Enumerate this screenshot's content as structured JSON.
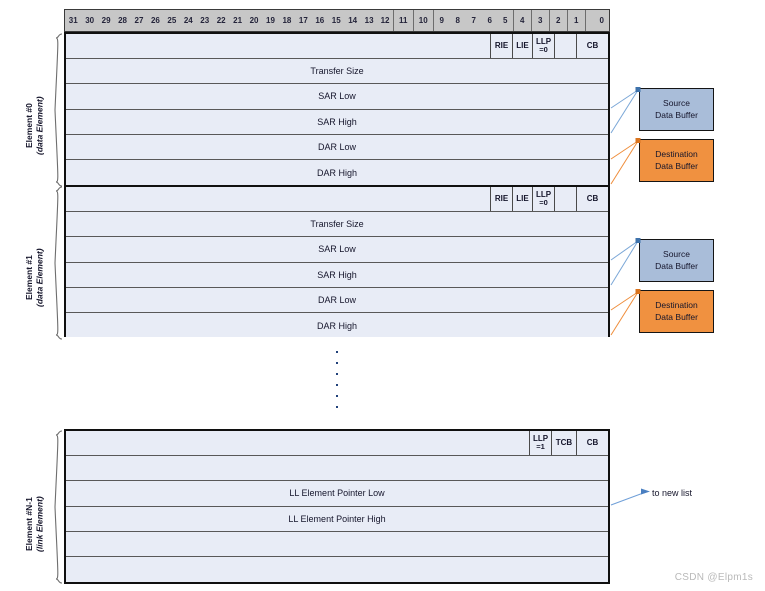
{
  "diagram": {
    "title": "DMA Linked List Element Layout",
    "watermark": "CSDN @Elpm1s"
  },
  "bit_header": {
    "bits": [
      "31",
      "30",
      "29",
      "28",
      "27",
      "26",
      "25",
      "24",
      "23",
      "22",
      "21",
      "20",
      "19",
      "18",
      "17",
      "16",
      "15",
      "14",
      "13",
      "12",
      "11",
      "10",
      "9",
      "8",
      "7",
      "6",
      "5",
      "4",
      "3",
      "2",
      "1",
      "0"
    ]
  },
  "elements": [
    {
      "id": "element-0",
      "label_line1": "Element #0",
      "label_line2": "(data Element)",
      "rows": [
        {
          "name": "control",
          "text": "",
          "flags": [
            {
              "label": "RIE",
              "sub": ""
            },
            {
              "label": "LIE",
              "sub": ""
            },
            {
              "label": "LLP",
              "sub": "=0"
            },
            {
              "label": "",
              "sub": ""
            },
            {
              "label": "CB",
              "sub": ""
            }
          ]
        },
        {
          "name": "transfer-size",
          "text": "Transfer Size"
        },
        {
          "name": "sar-low",
          "text": "SAR Low"
        },
        {
          "name": "sar-high",
          "text": "SAR High"
        },
        {
          "name": "dar-low",
          "text": "DAR Low"
        },
        {
          "name": "dar-high",
          "text": "DAR High"
        }
      ]
    },
    {
      "id": "element-1",
      "label_line1": "Element #1",
      "label_line2": "(data Element)",
      "rows": [
        {
          "name": "control",
          "text": "",
          "flags": [
            {
              "label": "RIE",
              "sub": ""
            },
            {
              "label": "LIE",
              "sub": ""
            },
            {
              "label": "LLP",
              "sub": "=0"
            },
            {
              "label": "",
              "sub": ""
            },
            {
              "label": "CB",
              "sub": ""
            }
          ]
        },
        {
          "name": "transfer-size",
          "text": "Transfer Size"
        },
        {
          "name": "sar-low",
          "text": "SAR Low"
        },
        {
          "name": "sar-high",
          "text": "SAR High"
        },
        {
          "name": "dar-low",
          "text": "DAR Low"
        },
        {
          "name": "dar-high",
          "text": "DAR High"
        }
      ]
    },
    {
      "id": "element-n-1",
      "label_line1": "Element #N-1",
      "label_line2": "(link Element)",
      "rows": [
        {
          "name": "control",
          "text": "",
          "flags": [
            {
              "label": "LLP",
              "sub": "=1"
            },
            {
              "label": "TCB",
              "sub": ""
            },
            {
              "label": "CB",
              "sub": ""
            }
          ]
        },
        {
          "name": "reserved-1",
          "text": ""
        },
        {
          "name": "ll-element-pointer-low",
          "text": "LL Element Pointer Low"
        },
        {
          "name": "ll-element-pointer-high",
          "text": "LL Element Pointer High"
        },
        {
          "name": "reserved-2",
          "text": ""
        },
        {
          "name": "reserved-3",
          "text": ""
        }
      ]
    }
  ],
  "buffers": [
    {
      "id": "src-0",
      "line1": "Source",
      "line2": "Data Buffer",
      "color": "#a9bdd9"
    },
    {
      "id": "dst-0",
      "line1": "Destination",
      "line2": "Data Buffer",
      "color": "#f09140"
    },
    {
      "id": "src-1",
      "line1": "Source",
      "line2": "Data Buffer",
      "color": "#a9bdd9"
    },
    {
      "id": "dst-1",
      "line1": "Destination",
      "line2": "Data Buffer",
      "color": "#f09140"
    }
  ],
  "annotations": {
    "new_list": "to new list"
  },
  "colors": {
    "source_fill": "#a9bdd9",
    "destination_fill": "#f09140",
    "row_fill": "#e8ecf6",
    "header_fill": "#c7c7c7",
    "source_connector": "#7ba7d7",
    "destination_connector": "#ef8e3c",
    "pointer_connector": "#6f9fd8"
  },
  "ellipsis": {
    "dot_count": 6
  }
}
